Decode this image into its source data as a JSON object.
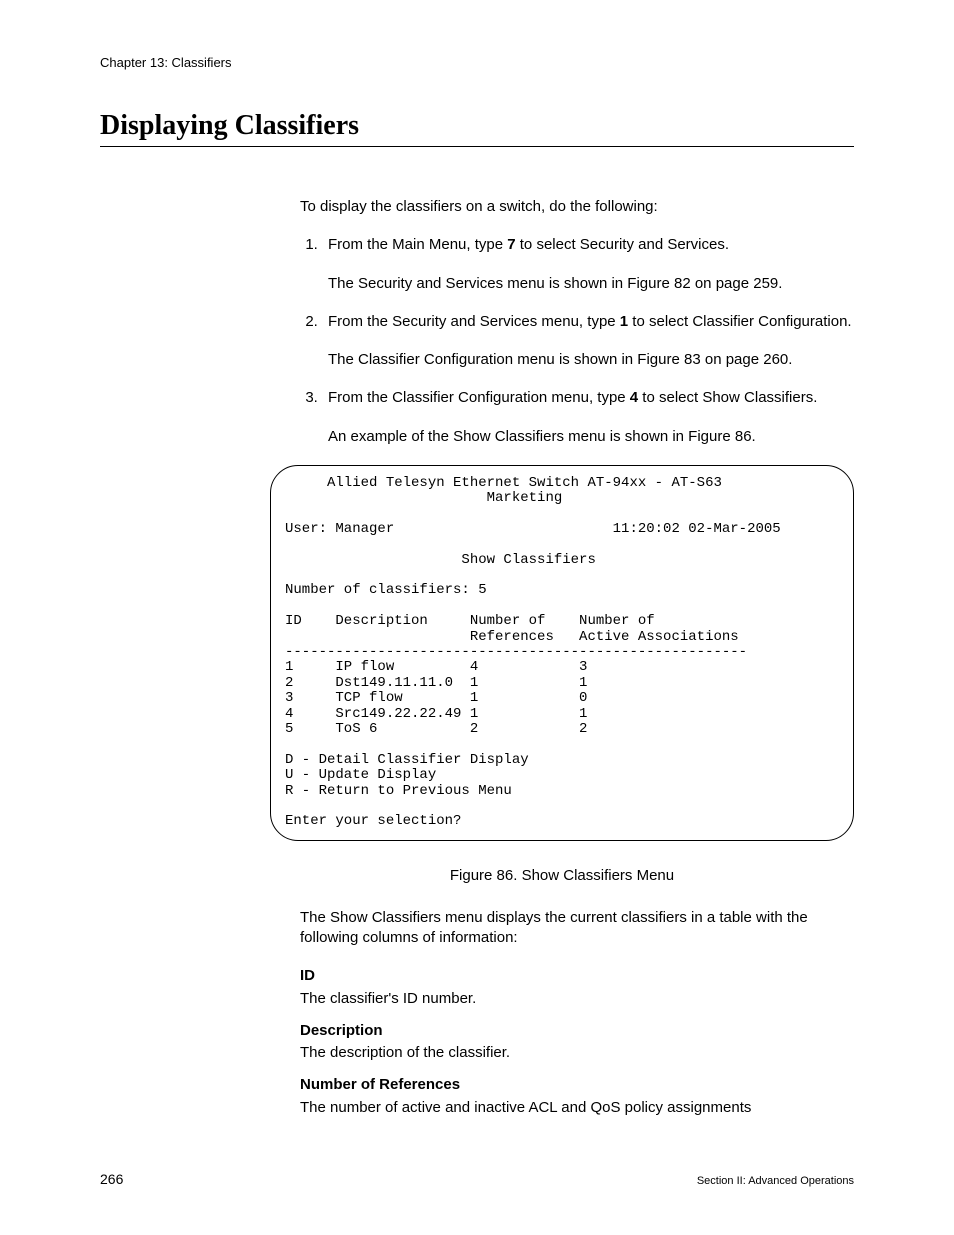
{
  "header": "Chapter 13: Classifiers",
  "title": "Displaying Classifiers",
  "intro": "To display the classifiers on a switch, do the following:",
  "steps": [
    {
      "pre": "From the Main Menu, type ",
      "bold": "7",
      "post": " to select Security and Services.",
      "followups": [
        "The Security and Services menu is shown in Figure 82 on page 259."
      ]
    },
    {
      "pre": "From the Security and Services menu, type ",
      "bold": "1",
      "post": " to select Classifier Configuration.",
      "followups": [
        "The Classifier Configuration menu is shown in Figure 83 on page 260."
      ]
    },
    {
      "pre": "From the Classifier Configuration menu, type ",
      "bold": "4",
      "post": " to select Show Classifiers.",
      "followups": [
        "An example of the Show Classifiers menu is shown in Figure 86."
      ]
    }
  ],
  "terminal": {
    "title_line": "     Allied Telesyn Ethernet Switch AT-94xx - AT-S63",
    "subtitle": "                        Marketing",
    "user_line": "User: Manager                          11:20:02 02-Mar-2005",
    "menu_title": "                     Show Classifiers",
    "count_line": "Number of classifiers: 5",
    "header1": "ID    Description     Number of    Number of",
    "header2": "                      References   Active Associations",
    "divider": "-------------------------------------------------------",
    "rows": [
      "1     IP flow         4            3",
      "2     Dst149.11.11.0  1            1",
      "3     TCP flow        1            0",
      "4     Src149.22.22.49 1            1",
      "5     ToS 6           2            2"
    ],
    "options": [
      "D - Detail Classifier Display",
      "U - Update Display",
      "R - Return to Previous Menu"
    ],
    "prompt": "Enter your selection?"
  },
  "figure_caption": "Figure 86. Show Classifiers Menu",
  "after_figure": "The Show Classifiers menu displays the current classifiers in a table with the following columns of information:",
  "defs": [
    {
      "term": "ID",
      "desc": "The classifier's ID number."
    },
    {
      "term": "Description",
      "desc": "The description of the classifier."
    },
    {
      "term": "Number of References",
      "desc": "The number of active and inactive ACL and QoS policy assignments"
    }
  ],
  "footer": {
    "page": "266",
    "section": "Section II: Advanced Operations"
  }
}
